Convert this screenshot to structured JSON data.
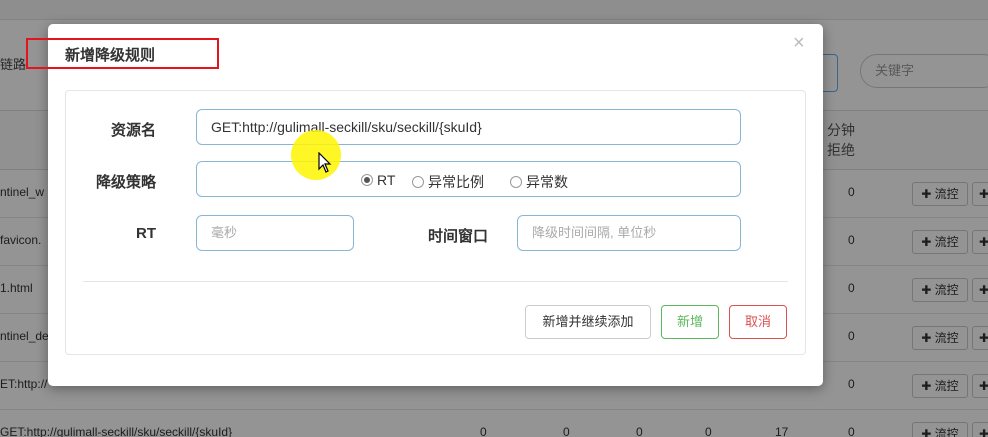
{
  "background": {
    "breadcrumb": "链路",
    "keyword_placeholder": "关键字",
    "column_header": "分钟拒绝",
    "rows": [
      {
        "resource": "ntinel_w",
        "value": "0",
        "btn": "✚ 流控",
        "btn2": "✚"
      },
      {
        "resource": "favicon.",
        "value": "0",
        "btn": "✚ 流控",
        "btn2": "✚"
      },
      {
        "resource": "1.html",
        "value": "0",
        "btn": "✚ 流控",
        "btn2": "✚"
      },
      {
        "resource": "ntinel_de",
        "value": "0",
        "btn": "✚ 流控",
        "btn2": "✚"
      },
      {
        "resource": "ET:http://",
        "value": "0",
        "btn": "✚ 流控",
        "btn2": "✚"
      }
    ],
    "last_row": {
      "resource": "GET:http://gulimall-seckill/sku/seckill/{skuId}",
      "n1": "0",
      "n2": "0",
      "n3": "0",
      "n4": "0",
      "n5": "17",
      "n6": "0",
      "btn": "✚ 流控",
      "btn2": "✚"
    }
  },
  "modal": {
    "title": "新增降级规则",
    "close": "×",
    "resource_label": "资源名",
    "resource_value": "GET:http://gulimall-seckill/sku/seckill/{skuId}",
    "strategy_label": "降级策略",
    "strategy_options": [
      {
        "label": "RT",
        "checked": true
      },
      {
        "label": "异常比例",
        "checked": false
      },
      {
        "label": "异常数",
        "checked": false
      }
    ],
    "rt_label": "RT",
    "rt_placeholder": "毫秒",
    "window_label": "时间窗口",
    "window_placeholder": "降级时间间隔, 单位秒",
    "buttons": {
      "add_continue": "新增并继续添加",
      "add": "新增",
      "cancel": "取消"
    }
  },
  "colors": {
    "highlight_border": "#e4141c",
    "success": "#5cb85c",
    "danger": "#d9534f",
    "input_border": "#8ab6d6",
    "cursor_halo": "#fff500"
  }
}
